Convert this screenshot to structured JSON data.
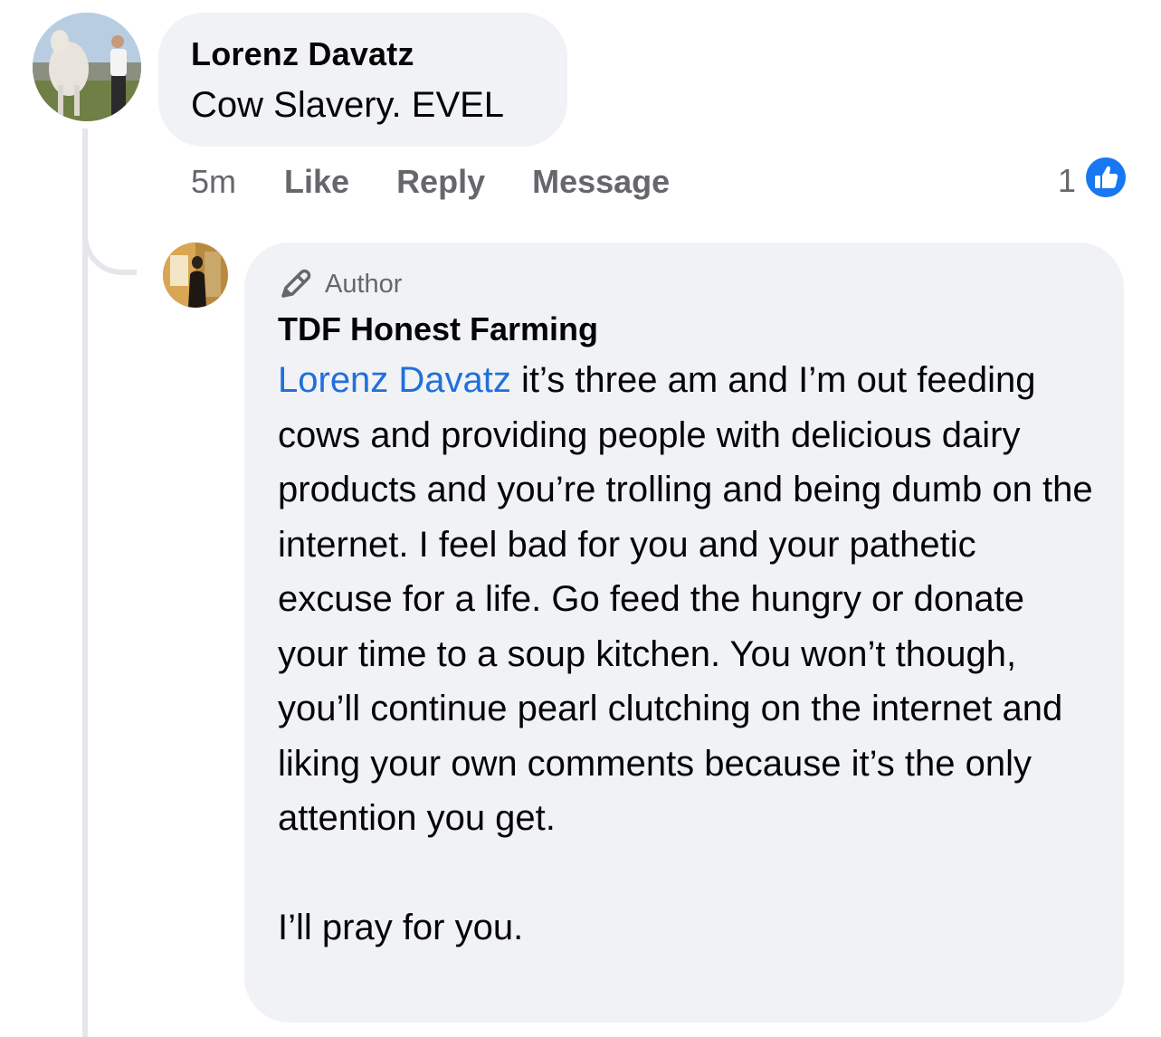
{
  "comment": {
    "author": "Lorenz Davatz",
    "text": "Cow Slavery. EVEL",
    "time": "5m",
    "actions": {
      "like": "Like",
      "reply": "Reply",
      "message": "Message"
    },
    "reaction_count": "1",
    "reaction_icon": "like-icon"
  },
  "reply": {
    "badge": "Author",
    "badge_icon": "pencil-author-icon",
    "author": "TDF Honest Farming",
    "mention": "Lorenz Davatz",
    "text_after_mention": " it’s three am and I’m out feeding cows and providing people with delicious dairy products and you’re trolling and being dumb on the internet. I feel bad for you and your pathetic excuse for a life. Go feed the hungry or donate your time to a soup kitchen. You won’t though, you’ll continue pearl clutching on the internet and liking your own comments because it’s the only attention you get.",
    "closing": "I’ll pray for you."
  },
  "colors": {
    "bubble": "#f0f2f5",
    "mention": "#216fdb",
    "meta": "#65676b",
    "like_blue": "#1877f2",
    "thread_line": "#e4e6eb"
  }
}
